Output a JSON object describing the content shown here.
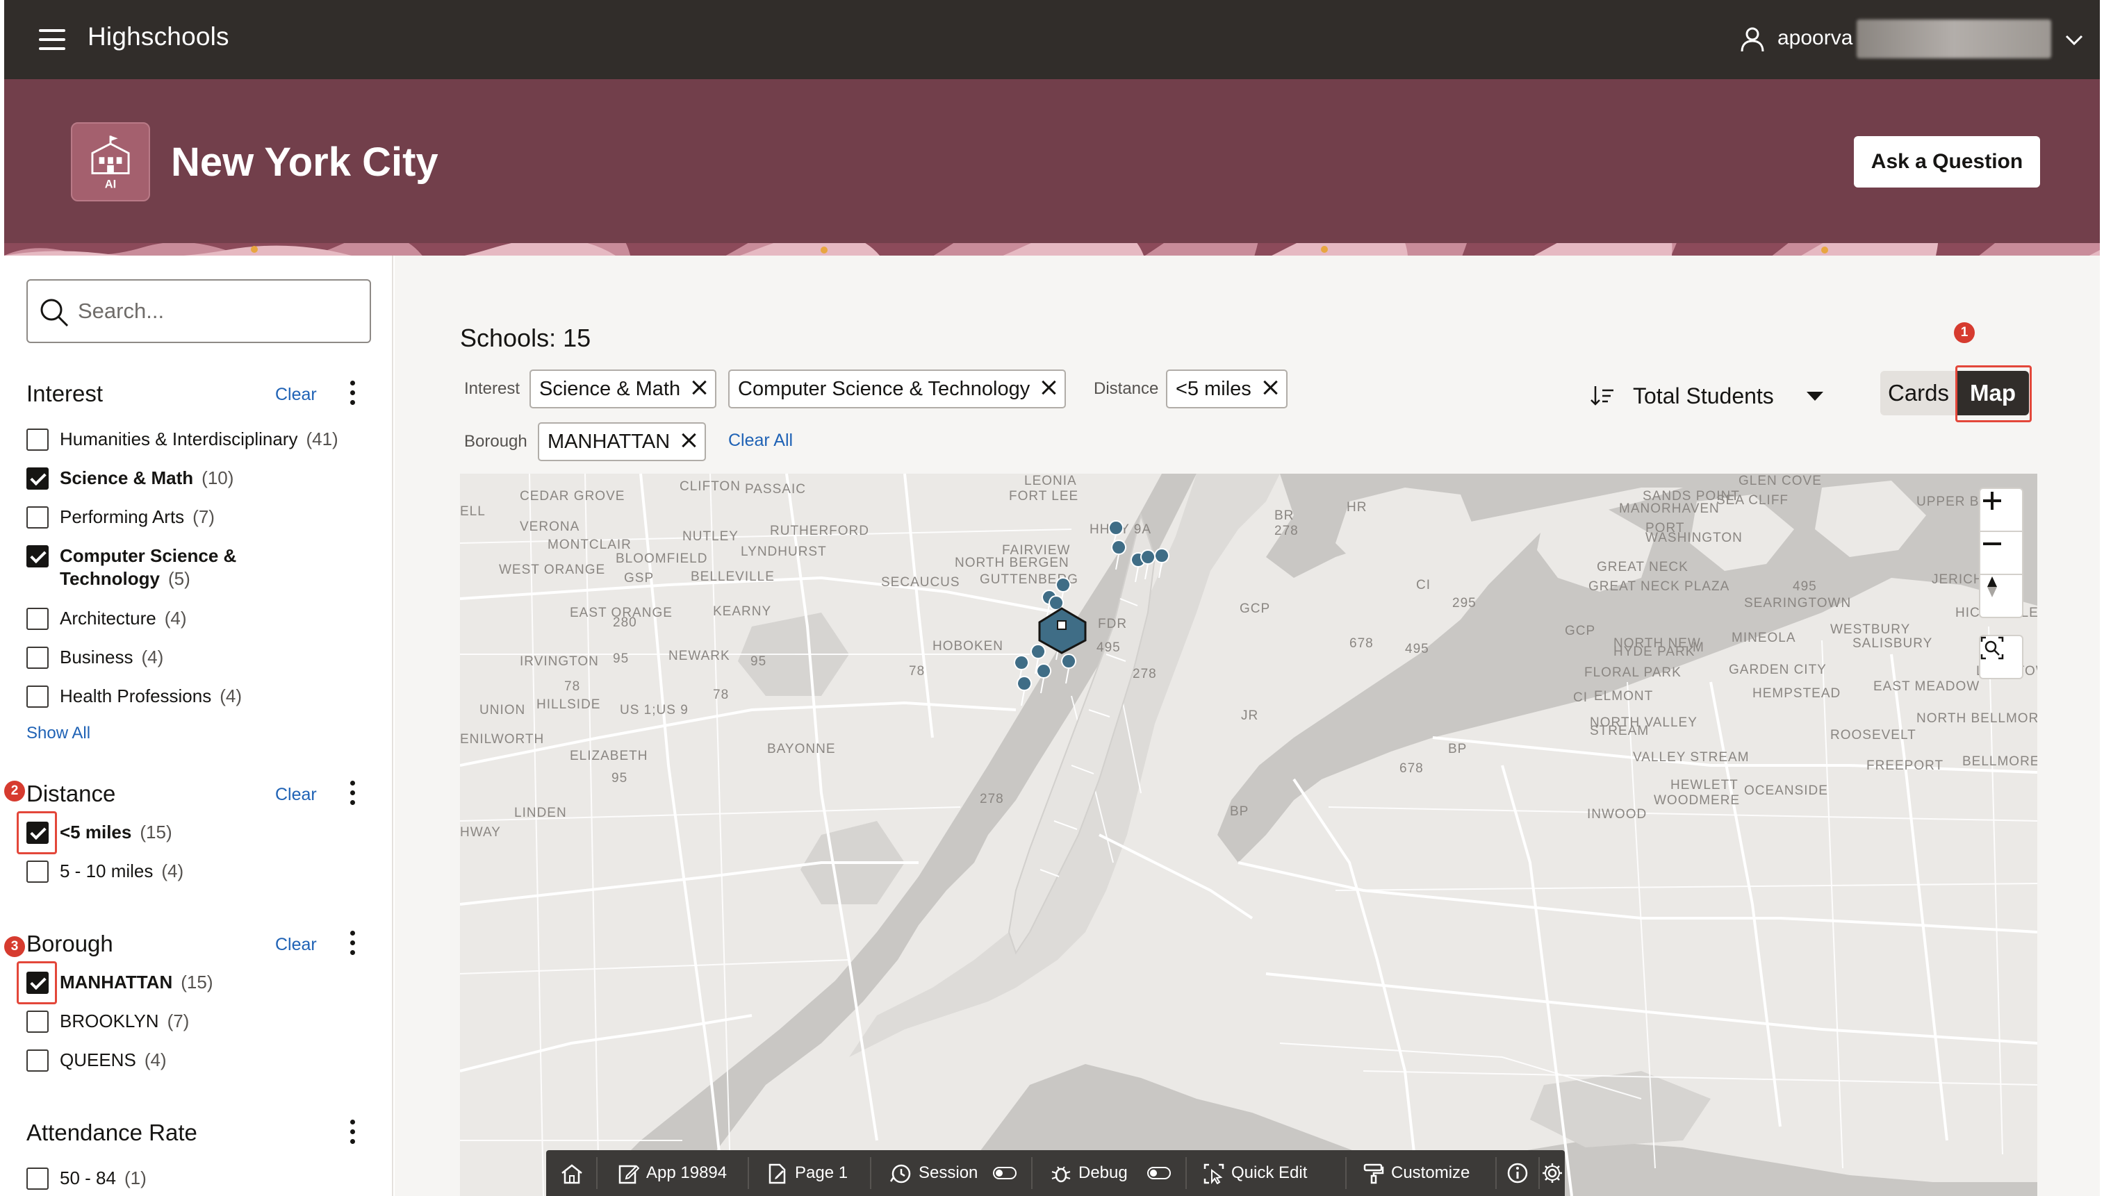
{
  "header": {
    "app_title": "Highschools",
    "user_name": "apoorva"
  },
  "hero": {
    "title": "New York City",
    "icon_badge": "AI",
    "ask_button": "Ask a Question"
  },
  "sidebar": {
    "search_placeholder": "Search...",
    "clear_label": "Clear",
    "show_all": "Show All",
    "facets": {
      "interest": {
        "title": "Interest",
        "options": [
          {
            "label": "Humanities & Interdisciplinary",
            "count": "(41)",
            "checked": false
          },
          {
            "label": "Science & Math",
            "count": "(10)",
            "checked": true
          },
          {
            "label": "Performing Arts",
            "count": "(7)",
            "checked": false
          },
          {
            "label": "Computer Science & Technology",
            "count": "(5)",
            "checked": true
          },
          {
            "label": "Architecture",
            "count": "(4)",
            "checked": false
          },
          {
            "label": "Business",
            "count": "(4)",
            "checked": false
          },
          {
            "label": "Health Professions",
            "count": "(4)",
            "checked": false
          }
        ]
      },
      "distance": {
        "title": "Distance",
        "options": [
          {
            "label": "<5 miles",
            "count": "(15)",
            "checked": true
          },
          {
            "label": "5 - 10 miles",
            "count": "(4)",
            "checked": false
          }
        ]
      },
      "borough": {
        "title": "Borough",
        "options": [
          {
            "label": "MANHATTAN",
            "count": "(15)",
            "checked": true
          },
          {
            "label": "BROOKLYN",
            "count": "(7)",
            "checked": false
          },
          {
            "label": "QUEENS",
            "count": "(4)",
            "checked": false
          }
        ]
      },
      "attendance": {
        "title": "Attendance Rate",
        "options": [
          {
            "label": "50 - 84",
            "count": "(1)",
            "checked": false
          }
        ]
      }
    },
    "annotation_badges": [
      "2",
      "3"
    ]
  },
  "main": {
    "schools_count": "Schools: 15",
    "filters": {
      "interest_label": "Interest",
      "interest_chips": [
        "Science & Math",
        "Computer Science & Technology"
      ],
      "distance_label": "Distance",
      "distance_chip": "<5 miles",
      "borough_label": "Borough",
      "borough_chip": "MANHATTAN",
      "clear_all": "Clear All"
    },
    "sort_label": "Total Students",
    "view_cards": "Cards",
    "view_map": "Map",
    "annotation_badge": "1"
  },
  "map": {
    "labels": [
      "LEONIA",
      "FORT LEE",
      "CLIFTON",
      "PASSAIC",
      "CEDAR GROVE",
      "ELL",
      "VERONA",
      "NUTLEY",
      "RUTHERFORD",
      "MONTCLAIR",
      "BLOOMFIELD",
      "LYNDHURST",
      "WEST ORANGE",
      "GSP",
      "BELLEVILLE",
      "SECAUCUS",
      "FAIRVIEW",
      "NORTH BERGEN",
      "GUTTENBERG",
      "EAST ORANGE",
      "KEARNY",
      "NEWARK",
      "IRVINGTON",
      "HOBOKEN",
      "HILLSIDE",
      "UNION",
      "US 1;US 9",
      "ENILWORTH",
      "ELIZABETH",
      "BAYONNE",
      "LINDEN",
      "HWAY",
      "GLEN COVE",
      "SANDS POINT",
      "SEA CLIFF",
      "MANORHAVEN",
      "UPPER B",
      "PORT WASHINGTON",
      "GREAT NECK",
      "GREAT NECK PLAZA",
      "JERICH",
      "SEARINGTOWN",
      "HICKSVILLE",
      "WESTBURY",
      "SALISBURY",
      "MINEOLA",
      "NORTH NEW HYDE PARK",
      "FLORAL PARK",
      "GARDEN CITY",
      "LEVITTOW",
      "EAST MEADOW",
      "HEMPSTEAD",
      "ELMONT",
      "NORTH VALLEY STREAM",
      "ROOSEVELT",
      "NORTH BELLMORE",
      "VALLEY STREAM",
      "FREEPORT",
      "BELLMORE",
      "HEWLETT",
      "WOODMERE",
      "OCEANSIDE",
      "INWOOD",
      "HHNY 9A",
      "BR",
      "HR",
      "278",
      "295",
      "495",
      "678",
      "GCP",
      "FDR",
      "CI",
      "CIP",
      "JR",
      "BP",
      "95",
      "80",
      "280",
      "78",
      "R"
    ]
  },
  "dev_toolbar": {
    "app": "App 19894",
    "page": "Page 1",
    "session": "Session",
    "debug": "Debug",
    "quick_edit": "Quick Edit",
    "customize": "Customize"
  }
}
